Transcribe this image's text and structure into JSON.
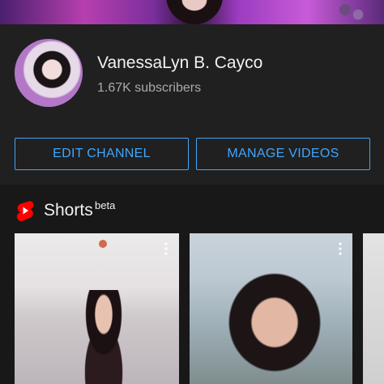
{
  "channel": {
    "name": "VanessaLyn B. Cayco",
    "subscribers": "1.67K subscribers"
  },
  "buttons": {
    "edit": "EDIT CHANNEL",
    "manage": "MANAGE VIDEOS"
  },
  "shorts": {
    "title": "Shorts",
    "badge": "beta",
    "items": [
      {
        "more_icon": "more-vert-icon"
      },
      {
        "more_icon": "more-vert-icon"
      },
      {
        "more_icon": "more-vert-icon"
      }
    ]
  },
  "colors": {
    "accent": "#3ea6ff",
    "background": "#181818",
    "header_background": "#202020",
    "shorts_red": "#ff0000"
  }
}
